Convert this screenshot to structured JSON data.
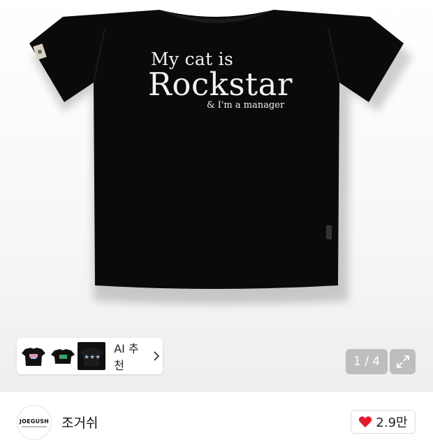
{
  "product": {
    "print": {
      "line1": "My cat is",
      "line2": "Rockstar",
      "line3": "& I'm a manager"
    },
    "colors": {
      "shirt": "#0a0a0a",
      "print": "#f2f2f2"
    }
  },
  "recommendation": {
    "label": "AI 추천",
    "thumbnails": [
      "black-tee-graphic-thumbnail",
      "black-crop-tee-thumbnail",
      "black-tee-stars-thumbnail"
    ]
  },
  "gallery": {
    "counter": "1 / 4",
    "expand_icon": "expand-icon"
  },
  "brand": {
    "logo_text": "JOEGUSH",
    "name": "조거쉬"
  },
  "likes": {
    "count": "2.9만",
    "icon": "heart-icon",
    "color": "#e8192c"
  }
}
